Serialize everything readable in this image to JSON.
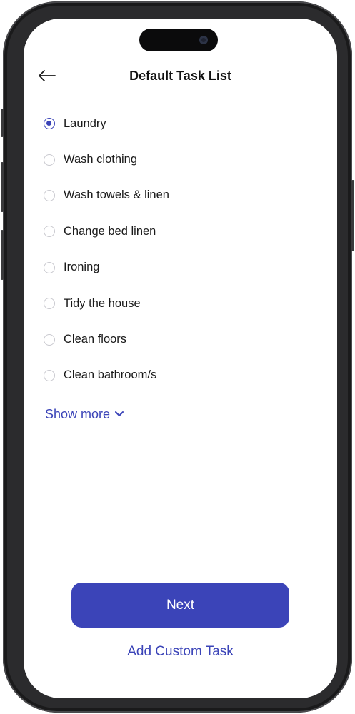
{
  "header": {
    "title": "Default Task List",
    "back_icon": "arrow-left-icon"
  },
  "tasks": [
    {
      "label": "Laundry",
      "selected": true
    },
    {
      "label": "Wash clothing",
      "selected": false
    },
    {
      "label": "Wash towels & linen",
      "selected": false
    },
    {
      "label": "Change bed linen",
      "selected": false
    },
    {
      "label": "Ironing",
      "selected": false
    },
    {
      "label": "Tidy the house",
      "selected": false
    },
    {
      "label": "Clean floors",
      "selected": false
    },
    {
      "label": "Clean bathroom/s",
      "selected": false
    }
  ],
  "show_more": {
    "label": "Show more",
    "icon": "chevron-down-icon"
  },
  "actions": {
    "next_label": "Next",
    "add_custom_label": "Add Custom Task"
  },
  "colors": {
    "accent": "#3b44b8",
    "text": "#1a1a1a",
    "radio_border": "#c9c9cf"
  }
}
